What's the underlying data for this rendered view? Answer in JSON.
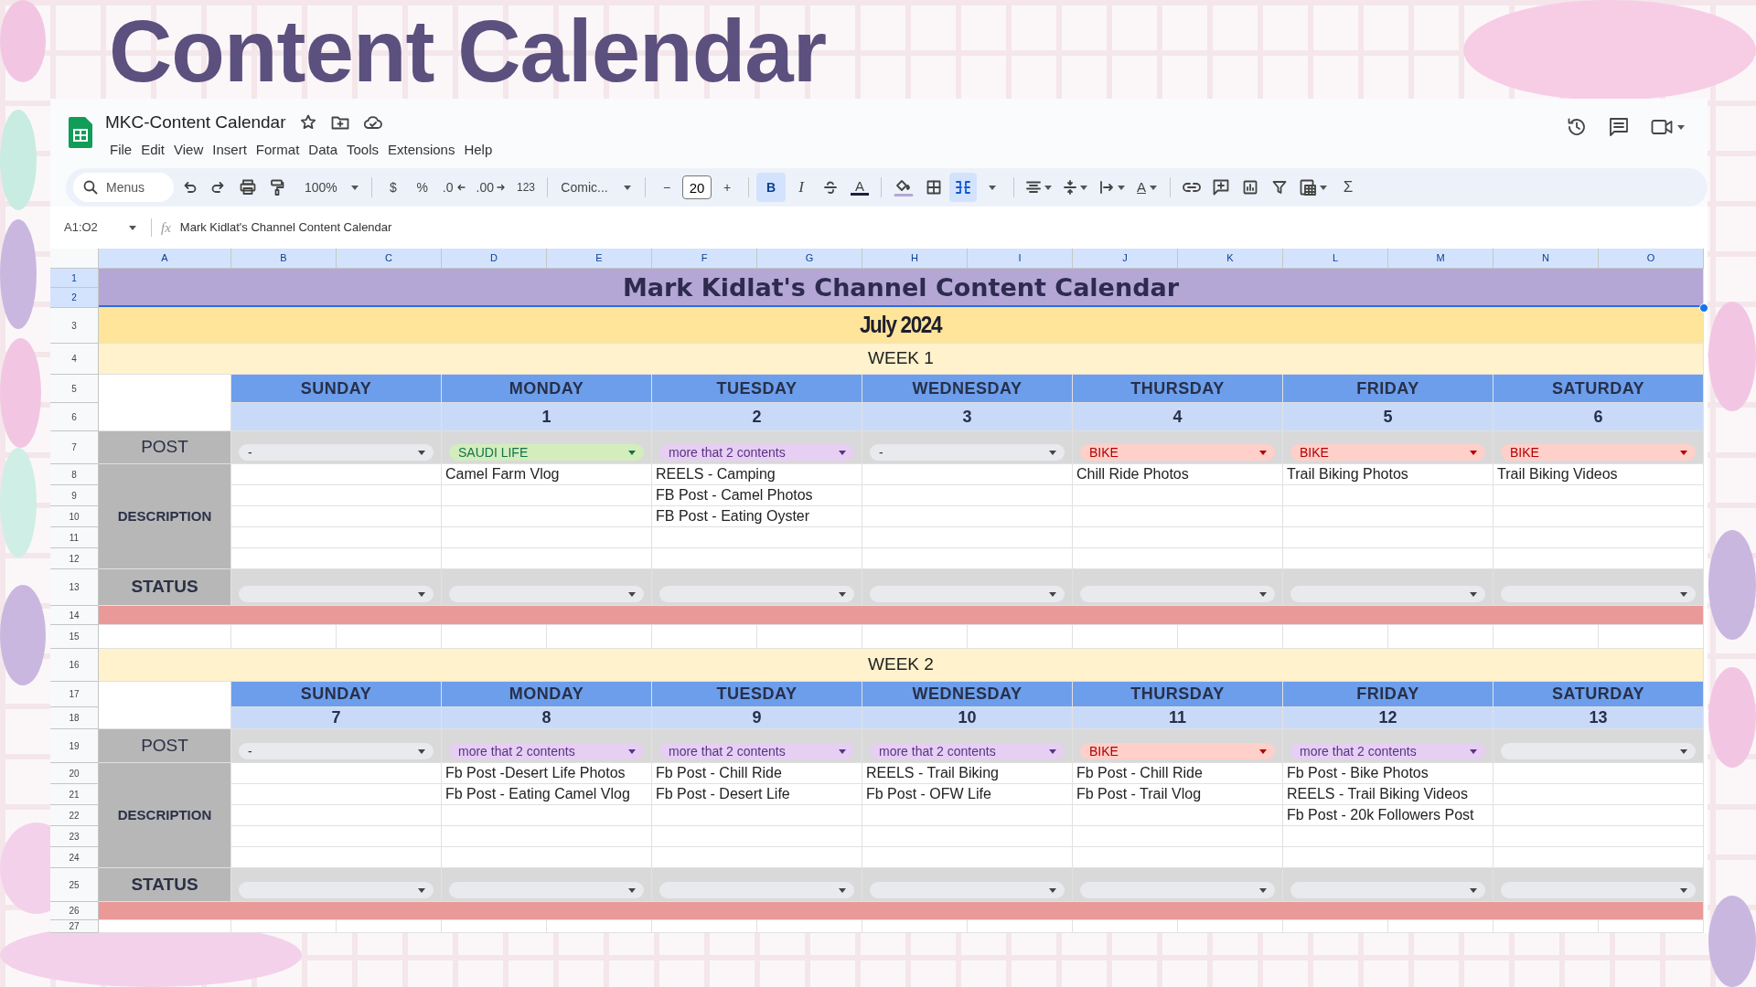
{
  "page_title": "Content Calendar",
  "document": {
    "title": "MKC-Content Calendar",
    "menu": [
      "File",
      "Edit",
      "View",
      "Insert",
      "Format",
      "Data",
      "Tools",
      "Extensions",
      "Help"
    ]
  },
  "toolbar": {
    "search_placeholder": "Menus",
    "zoom": "100%",
    "currency": "$",
    "percent": "%",
    "decrease_decimal": ".0",
    "increase_decimal": ".00",
    "number_format": "123",
    "font": "Comic...",
    "font_size": "20",
    "minus": "−",
    "plus": "+",
    "bold": {
      "label": "B",
      "selected": true
    },
    "italic": {
      "label": "I",
      "selected": false
    },
    "text_color": "A",
    "merge_selected": true,
    "rotation": "A",
    "sum": "Σ"
  },
  "formula_bar": {
    "name_box": "A1:O2",
    "fx": "fx",
    "formula": "Mark Kidlat's Channel Content Calendar"
  },
  "column_headers": [
    {
      "label": "A",
      "selected": true
    },
    {
      "label": "B",
      "selected": true
    },
    {
      "label": "C",
      "selected": true
    },
    {
      "label": "D",
      "selected": true
    },
    {
      "label": "E",
      "selected": true
    },
    {
      "label": "F",
      "selected": true
    },
    {
      "label": "G",
      "selected": true
    },
    {
      "label": "H",
      "selected": true
    },
    {
      "label": "I",
      "selected": true
    },
    {
      "label": "J",
      "selected": true
    },
    {
      "label": "K",
      "selected": true
    },
    {
      "label": "L",
      "selected": true
    },
    {
      "label": "M",
      "selected": true
    },
    {
      "label": "N",
      "selected": true
    },
    {
      "label": "O",
      "selected": true
    }
  ],
  "row_numbers": [
    {
      "label": "1",
      "selected": true
    },
    {
      "label": "2",
      "selected": true
    },
    {
      "label": "3",
      "selected": false
    },
    {
      "label": "4",
      "selected": false
    },
    {
      "label": "5",
      "selected": false
    },
    {
      "label": "6",
      "selected": false
    },
    {
      "label": "7",
      "selected": false
    },
    {
      "label": "8",
      "selected": false
    },
    {
      "label": "9",
      "selected": false
    },
    {
      "label": "10",
      "selected": false
    },
    {
      "label": "11",
      "selected": false
    },
    {
      "label": "12",
      "selected": false
    },
    {
      "label": "13",
      "selected": false
    },
    {
      "label": "14",
      "selected": false
    },
    {
      "label": "15",
      "selected": false
    },
    {
      "label": "16",
      "selected": false
    },
    {
      "label": "17",
      "selected": false
    },
    {
      "label": "18",
      "selected": false
    },
    {
      "label": "19",
      "selected": false
    },
    {
      "label": "20",
      "selected": false
    },
    {
      "label": "21",
      "selected": false
    },
    {
      "label": "22",
      "selected": false
    },
    {
      "label": "23",
      "selected": false
    },
    {
      "label": "24",
      "selected": false
    },
    {
      "label": "25",
      "selected": false
    },
    {
      "label": "26",
      "selected": false
    },
    {
      "label": "27",
      "selected": false
    }
  ],
  "sheet": {
    "title": {
      "text": "Mark Kidlat's Channel Content Calendar",
      "selected": true
    },
    "month": "July 2024",
    "weeks": [
      {
        "label": "WEEK 1",
        "row_labels": {
          "post": "POST",
          "description": "DESCRIPTION",
          "status": "STATUS"
        },
        "days": [
          {
            "name": "SUNDAY",
            "post": {
              "kind": "plain",
              "value": "-"
            }
          },
          {
            "name": "MONDAY",
            "date": "1",
            "post": {
              "kind": "saudi",
              "value": "SAUDI LIFE"
            },
            "descriptions": [
              "Camel Farm Vlog"
            ]
          },
          {
            "name": "TUESDAY",
            "date": "2",
            "post": {
              "kind": "multi",
              "value": "more that 2 contents"
            },
            "descriptions": [
              "REELS - Camping",
              "FB Post - Camel Photos",
              "FB Post - Eating Oyster"
            ]
          },
          {
            "name": "WEDNESDAY",
            "date": "3",
            "post": {
              "kind": "plain",
              "value": "-"
            }
          },
          {
            "name": "THURSDAY",
            "date": "4",
            "post": {
              "kind": "bike",
              "value": "BIKE"
            },
            "descriptions": [
              "Chill Ride Photos"
            ]
          },
          {
            "name": "FRIDAY",
            "date": "5",
            "post": {
              "kind": "bike",
              "value": "BIKE"
            },
            "descriptions": [
              "Trail Biking Photos"
            ]
          },
          {
            "name": "SATURDAY",
            "date": "6",
            "post": {
              "kind": "bike",
              "value": "BIKE"
            },
            "descriptions": [
              "Trail Biking Videos"
            ]
          }
        ]
      },
      {
        "label": "WEEK 2",
        "row_labels": {
          "post": "POST",
          "description": "DESCRIPTION",
          "status": "STATUS"
        },
        "days": [
          {
            "name": "SUNDAY",
            "date": "7",
            "post": {
              "kind": "plain",
              "value": "-"
            }
          },
          {
            "name": "MONDAY",
            "date": "8",
            "post": {
              "kind": "multi",
              "value": "more that 2 contents"
            },
            "descriptions": [
              "Fb Post -Desert Life Photos",
              "Fb Post - Eating Camel Vlog"
            ]
          },
          {
            "name": "TUESDAY",
            "date": "9",
            "post": {
              "kind": "multi",
              "value": "more that 2 contents"
            },
            "descriptions": [
              "Fb Post - Chill Ride",
              "Fb Post - Desert Life"
            ]
          },
          {
            "name": "WEDNESDAY",
            "date": "10",
            "post": {
              "kind": "multi",
              "value": "more that 2 contents"
            },
            "descriptions": [
              "REELS - Trail Biking",
              "Fb Post - OFW Life"
            ]
          },
          {
            "name": "THURSDAY",
            "date": "11",
            "post": {
              "kind": "bike",
              "value": "BIKE"
            },
            "descriptions": [
              "Fb Post - Chill Ride",
              "Fb Post - Trail Vlog"
            ]
          },
          {
            "name": "FRIDAY",
            "date": "12",
            "post": {
              "kind": "multi",
              "value": "more that 2 contents"
            },
            "descriptions": [
              "Fb Post - Bike Photos",
              "REELS - Trail Biking Videos",
              "Fb Post - 20k Followers Post"
            ]
          },
          {
            "name": "SATURDAY",
            "date": "13",
            "post": {
              "kind": "plain"
            }
          }
        ]
      }
    ]
  }
}
